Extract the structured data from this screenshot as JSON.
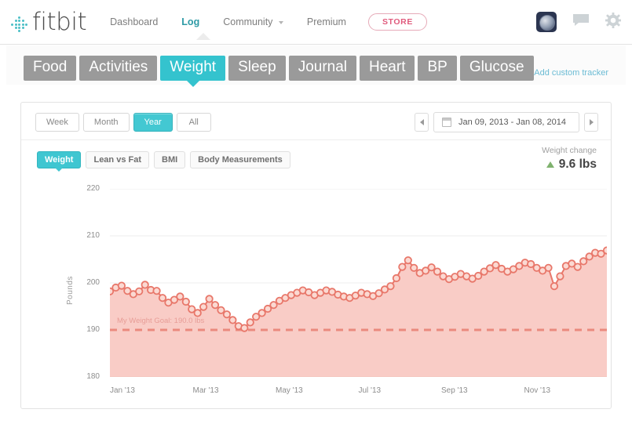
{
  "brand": {
    "name": "fitbit"
  },
  "topnav": {
    "items": [
      {
        "label": "Dashboard",
        "active": false,
        "caret": false
      },
      {
        "label": "Log",
        "active": true,
        "caret": false
      },
      {
        "label": "Community",
        "active": false,
        "caret": true
      },
      {
        "label": "Premium",
        "active": false,
        "caret": false
      }
    ],
    "store_label": "STORE",
    "icons": [
      "user-avatar",
      "chat-bubble-icon",
      "gear-icon"
    ]
  },
  "tabstrip": {
    "tabs": [
      {
        "label": "Food",
        "active": false
      },
      {
        "label": "Activities",
        "active": false
      },
      {
        "label": "Weight",
        "active": true
      },
      {
        "label": "Sleep",
        "active": false
      },
      {
        "label": "Journal",
        "active": false
      },
      {
        "label": "Heart",
        "active": false
      },
      {
        "label": "BP",
        "active": false
      },
      {
        "label": "Glucose",
        "active": false
      }
    ],
    "add_tracker_label": "Add custom tracker"
  },
  "card": {
    "periods": [
      {
        "label": "Week",
        "active": false
      },
      {
        "label": "Month",
        "active": false
      },
      {
        "label": "Year",
        "active": true
      },
      {
        "label": "All",
        "active": false
      }
    ],
    "date_range": "Jan 09, 2013 - Jan 08, 2014",
    "prev_label": "◀",
    "next_label": "▶",
    "subtabs": [
      {
        "label": "Weight",
        "active": true
      },
      {
        "label": "Lean vs Fat",
        "active": false
      },
      {
        "label": "BMI",
        "active": false
      },
      {
        "label": "Body Measurements",
        "active": false
      }
    ],
    "weight_change": {
      "label": "Weight change",
      "value": "9.6 lbs",
      "direction": "up"
    }
  },
  "colors": {
    "accent_teal": "#34c3ce",
    "line_coral": "#e8776a",
    "area_pink": "#f9c9c3",
    "goal_dash": "#ea8a7e",
    "store_pink": "#e05a7c",
    "link_blue": "#6bbbd4"
  },
  "chart_data": {
    "type": "line",
    "title": "",
    "xlabel": "",
    "ylabel": "Pounds",
    "ylim": [
      180,
      220
    ],
    "yticks": [
      180,
      190,
      200,
      210,
      220
    ],
    "xticks": [
      "Jan '13",
      "Mar '13",
      "May '13",
      "Jul '13",
      "Sep '13",
      "Nov '13"
    ],
    "grid": true,
    "legend": "none",
    "goal_line": {
      "value": 190.0,
      "label": "My Weight Goal: 190.0 lbs",
      "style": "dashed"
    },
    "series": [
      {
        "name": "Weight",
        "unit": "lbs",
        "values": [
          198.2,
          199.0,
          199.4,
          198.3,
          197.6,
          198.2,
          199.6,
          198.5,
          198.3,
          196.8,
          195.8,
          196.4,
          197.1,
          196.0,
          194.4,
          193.6,
          194.9,
          196.6,
          195.3,
          194.2,
          193.3,
          192.1,
          190.8,
          190.4,
          191.6,
          192.8,
          193.6,
          194.5,
          195.3,
          196.2,
          196.8,
          197.4,
          197.9,
          198.4,
          198.0,
          197.4,
          197.9,
          198.4,
          198.1,
          197.5,
          197.1,
          196.8,
          197.3,
          197.9,
          197.6,
          197.2,
          197.8,
          198.6,
          199.3,
          201.0,
          203.4,
          204.8,
          203.2,
          202.1,
          202.6,
          203.3,
          202.4,
          201.4,
          200.8,
          201.3,
          201.9,
          201.4,
          200.9,
          201.5,
          202.4,
          203.1,
          203.8,
          203.0,
          202.4,
          202.9,
          203.6,
          204.3,
          204.0,
          203.2,
          202.6,
          203.2,
          199.3,
          201.4,
          203.6,
          204.1,
          203.4,
          204.6,
          205.6,
          206.4,
          206.2,
          206.9
        ]
      }
    ],
    "summary": {
      "start": 198.2,
      "end": 206.9,
      "min": 190.4,
      "max": 206.9,
      "change": 9.6
    }
  }
}
